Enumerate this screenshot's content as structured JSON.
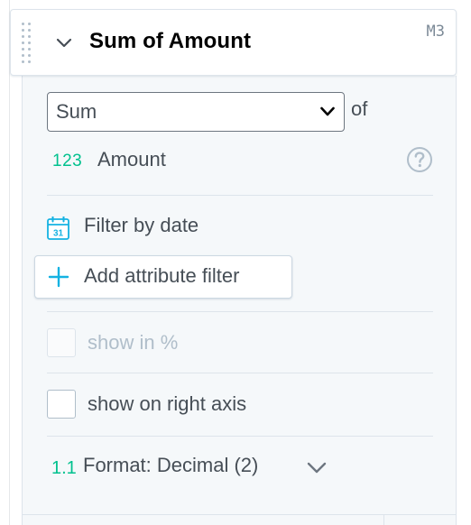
{
  "header": {
    "title": "Sum of Amount",
    "badge": "M3"
  },
  "aggregation": {
    "selected": "Sum",
    "of_label": "of"
  },
  "measure": {
    "icon_text": "123",
    "label": "Amount"
  },
  "filters": {
    "date_label": "Filter by date",
    "calendar_day": "31",
    "add_attribute_label": "Add attribute filter"
  },
  "options": {
    "show_in_percent": {
      "label": "show in %",
      "checked": false,
      "disabled": true
    },
    "show_on_right_axis": {
      "label": "show on right axis",
      "checked": false,
      "disabled": false
    }
  },
  "format": {
    "icon_text": "1.1",
    "label": "Format: Decimal (2)"
  },
  "icons": {
    "drag_handle": "grip-dots-icon",
    "collapse": "chevron-down-icon",
    "help": "question-circle-icon",
    "calendar": "calendar-icon",
    "add": "plus-icon"
  },
  "colors": {
    "accent_green": "#00c18e",
    "accent_blue": "#14b2e2",
    "text": "#464e56",
    "disabled_text": "#b0beca",
    "panel_bg": "#f5f8fa"
  }
}
